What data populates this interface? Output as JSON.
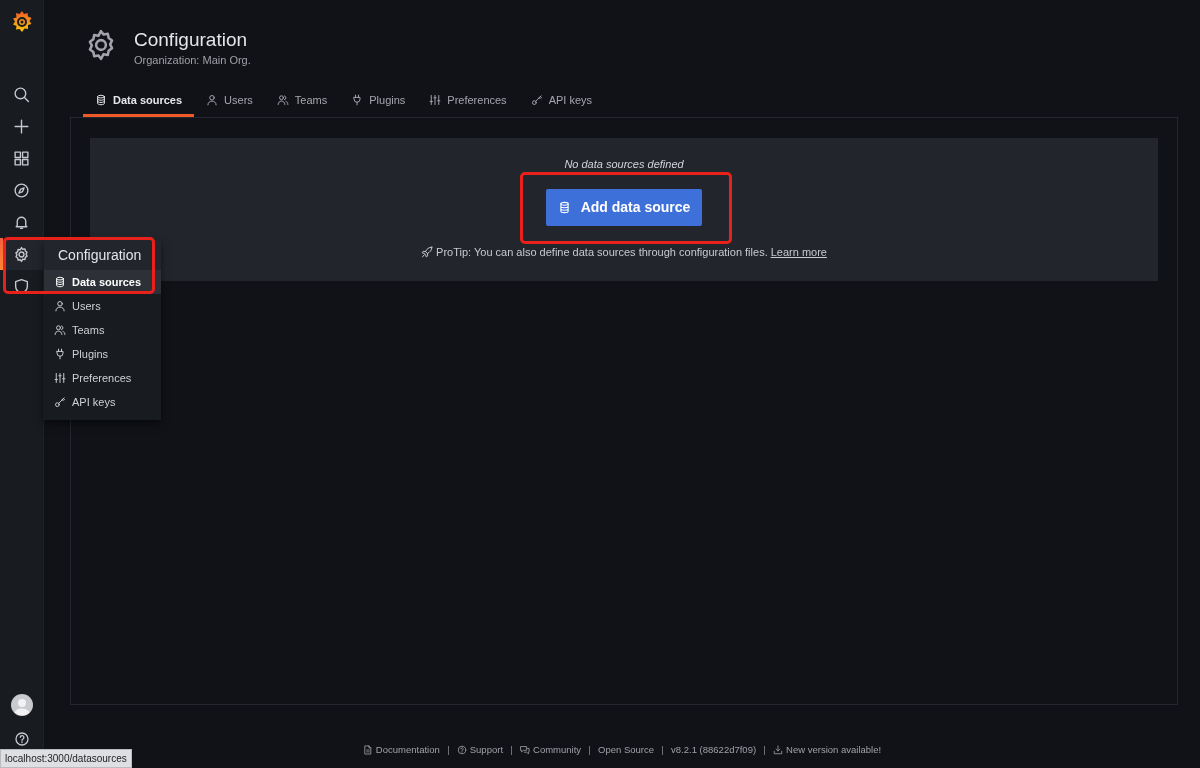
{
  "sidebar": {
    "items": [
      {
        "kind": "search",
        "selected": false
      },
      {
        "kind": "plus",
        "selected": false
      },
      {
        "kind": "apps",
        "selected": false
      },
      {
        "kind": "compass",
        "selected": false
      },
      {
        "kind": "bell",
        "selected": false
      },
      {
        "kind": "gear",
        "selected": true
      },
      {
        "kind": "shield",
        "selected": false
      }
    ],
    "bottom": [
      {
        "kind": "avatar"
      },
      {
        "kind": "help"
      }
    ]
  },
  "flyout": {
    "title": "Configuration",
    "items": [
      {
        "kind": "database",
        "label": "Data sources",
        "selected": true
      },
      {
        "kind": "user",
        "label": "Users",
        "selected": false
      },
      {
        "kind": "users",
        "label": "Teams",
        "selected": false
      },
      {
        "kind": "plug",
        "label": "Plugins",
        "selected": false
      },
      {
        "kind": "sliders",
        "label": "Preferences",
        "selected": false
      },
      {
        "kind": "key",
        "label": "API keys",
        "selected": false
      }
    ]
  },
  "header": {
    "title": "Configuration",
    "subtitle": "Organization: Main Org."
  },
  "tabs": [
    {
      "kind": "database",
      "label": "Data sources",
      "selected": true
    },
    {
      "kind": "user",
      "label": "Users",
      "selected": false
    },
    {
      "kind": "users",
      "label": "Teams",
      "selected": false
    },
    {
      "kind": "plug",
      "label": "Plugins",
      "selected": false
    },
    {
      "kind": "sliders",
      "label": "Preferences",
      "selected": false
    },
    {
      "kind": "key",
      "label": "API keys",
      "selected": false
    }
  ],
  "empty_state": {
    "message": "No data sources defined",
    "button": "Add data source",
    "protip": "ProTip: You can also define data sources through configuration files.",
    "link": "Learn more"
  },
  "footer": [
    {
      "kind": "doc",
      "label": "Documentation"
    },
    {
      "kind": "help",
      "label": "Support"
    },
    {
      "kind": "chat",
      "label": "Community"
    },
    {
      "kind": "none",
      "label": "Open Source"
    },
    {
      "kind": "none",
      "label": "v8.2.1 (88622d7f09)"
    },
    {
      "kind": "download",
      "label": "New version available!"
    }
  ],
  "highlights": {
    "menu": true,
    "add_button": true
  },
  "status_url": "localhost:3000/datasources"
}
